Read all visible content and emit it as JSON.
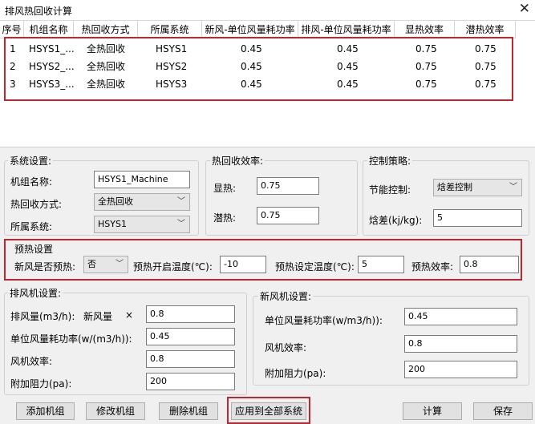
{
  "window": {
    "title": "排风热回收计算",
    "close": "✕"
  },
  "grid": {
    "headers": [
      "序号",
      "机组名称",
      "热回收方式",
      "所属系统",
      "新风-单位风量耗功率",
      "排风-单位风量耗功率",
      "显热效率",
      "潜热效率"
    ],
    "rows": [
      [
        "1",
        "HSYS1_...",
        "全热回收",
        "HSYS1",
        "0.45",
        "0.45",
        "0.75",
        "0.75"
      ],
      [
        "2",
        "HSYS2_...",
        "全热回收",
        "HSYS2",
        "0.45",
        "0.45",
        "0.75",
        "0.75"
      ],
      [
        "3",
        "HSYS3_...",
        "全热回收",
        "HSYS3",
        "0.45",
        "0.45",
        "0.75",
        "0.75"
      ]
    ]
  },
  "system_settings": {
    "title": "系统设置:",
    "unit_name_label": "机组名称:",
    "unit_name_value": "HSYS1_Machine",
    "recovery_mode_label": "热回收方式:",
    "recovery_mode_value": "全热回收",
    "system_label": "所属系统:",
    "system_value": "HSYS1"
  },
  "efficiency": {
    "title": "热回收效率:",
    "sensible_label": "显热:",
    "sensible_value": "0.75",
    "latent_label": "潜热:",
    "latent_value": "0.75"
  },
  "control": {
    "title": "控制策略:",
    "mode_label": "节能控制:",
    "mode_value": "焓差控制",
    "enthalpy_label": "焓差(kj/kg):",
    "enthalpy_value": "5"
  },
  "preheat": {
    "title": "预热设置",
    "enable_label": "新风是否预热:",
    "enable_value": "否",
    "start_temp_label": "预热开启温度(℃):",
    "start_temp_value": "-10",
    "set_temp_label": "预热设定温度(℃):",
    "set_temp_value": "5",
    "efficiency_label": "预热效率:",
    "efficiency_value": "0.8"
  },
  "exhaust_fan": {
    "title": "排风机设置:",
    "airflow_label": "排风量(m3/h):",
    "airflow_ref": "新风量",
    "multiply": "×",
    "airflow_factor": "0.8",
    "power_label": "单位风量耗功率(w/(m3/h)):",
    "power_value": "0.45",
    "fan_eff_label": "风机效率:",
    "fan_eff_value": "0.8",
    "resistance_label": "附加阻力(pa):",
    "resistance_value": "200"
  },
  "fresh_fan": {
    "title": "新风机设置:",
    "power_label": "单位风量耗功率(w/m3/h)):",
    "power_value": "0.45",
    "fan_eff_label": "风机效率:",
    "fan_eff_value": "0.8",
    "resistance_label": "附加阻力(pa):",
    "resistance_value": "200"
  },
  "buttons": {
    "add": "添加机组",
    "modify": "修改机组",
    "delete": "删除机组",
    "apply_all": "应用到全部系统",
    "calculate": "计算",
    "save": "保存"
  },
  "colors": {
    "highlight_border": "#c0272d",
    "window_bg": "#f0f0f0"
  }
}
